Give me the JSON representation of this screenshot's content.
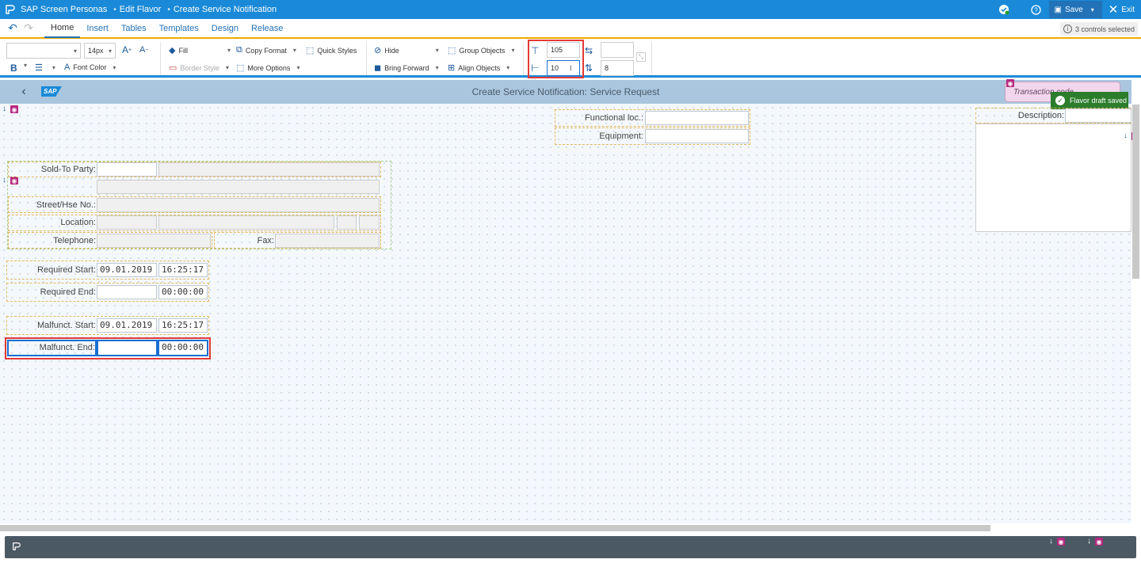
{
  "titlebar": {
    "app": "SAP Screen Personas",
    "mode": "Edit Flavor",
    "screen": "Create Service Notification",
    "save": "Save",
    "exit": "Exit"
  },
  "tabs": [
    "Home",
    "Insert",
    "Tables",
    "Templates",
    "Design",
    "Release"
  ],
  "active_tab": "Home",
  "selection_info": "3 controls selected",
  "ribbon": {
    "font_size": "14px",
    "bold": "B",
    "font_color": "Font Color",
    "fill": "Fill",
    "border_style": "Border Style",
    "copy_format": "Copy Format",
    "more_options": "More Options",
    "quick_styles": "Quick Styles",
    "hide": "Hide",
    "bring_forward": "Bring Forward",
    "group_objects": "Group Objects",
    "align_objects": "Align Objects",
    "top": "105",
    "left": "10",
    "width": "",
    "height": "8"
  },
  "screen_header": {
    "logo": "SAP",
    "title": "Create Service Notification: Service Request",
    "transaction": "Transaction code"
  },
  "toast": "Flavor draft saved",
  "form": {
    "functional_loc": "Functional loc.:",
    "equipment": "Equipment:",
    "description": "Description:",
    "sold_to": "Sold-To Party:",
    "street": "Street/Hse No.:",
    "location": "Location:",
    "telephone": "Telephone:",
    "fax": "Fax:",
    "req_start": "Required Start:",
    "req_start_date": "09.01.2019",
    "req_start_time": "16:25:17",
    "req_end": "Required End:",
    "req_end_date": "",
    "req_end_time": "00:00:00",
    "mal_start": "Malfunct. Start:",
    "mal_start_date": "09.01.2019",
    "mal_start_time": "16:25:17",
    "mal_end": "Malfunct. End:",
    "mal_end_date": "",
    "mal_end_time": "00:00:00"
  },
  "colors": {
    "shell_blue": "#1a8ad8",
    "accent_orange": "#f0ab00",
    "selection_blue": "#1a6fd0",
    "highlight_red": "#e53935",
    "toast_green": "#2b7d2b"
  }
}
